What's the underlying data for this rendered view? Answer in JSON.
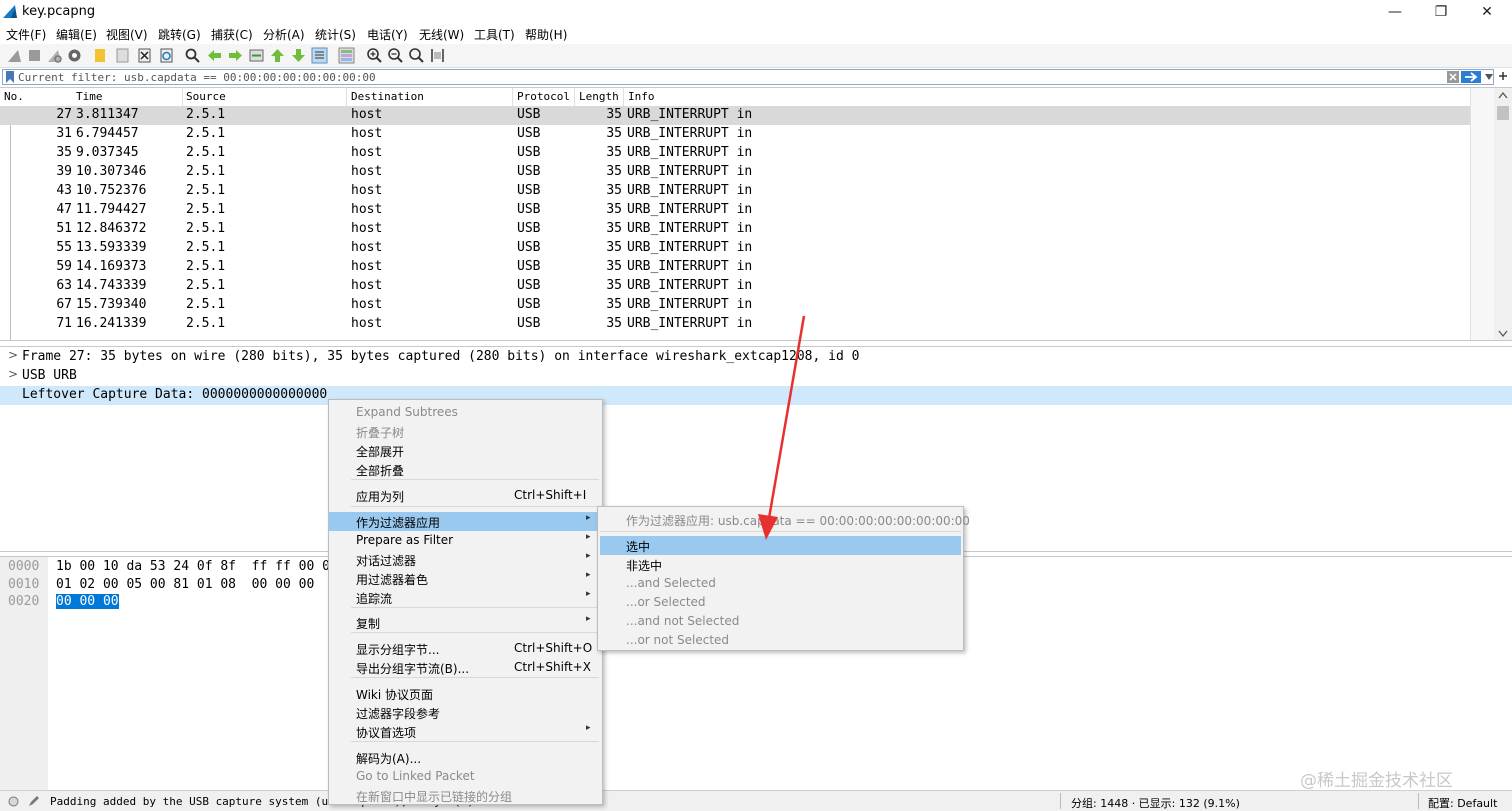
{
  "window": {
    "title": "key.pcapng",
    "controls": {
      "minimize": "—",
      "restore": "❐",
      "close": "✕"
    }
  },
  "menu": [
    {
      "label": "文件(F)"
    },
    {
      "label": "编辑(E)"
    },
    {
      "label": "视图(V)"
    },
    {
      "label": "跳转(G)"
    },
    {
      "label": "捕获(C)"
    },
    {
      "label": "分析(A)"
    },
    {
      "label": "统计(S)"
    },
    {
      "label": "电话(Y)"
    },
    {
      "label": "无线(W)"
    },
    {
      "label": "工具(T)"
    },
    {
      "label": "帮助(H)"
    }
  ],
  "toolbar_icons": [
    "shark-fin-start-icon",
    "stop-icon",
    "restart-icon",
    "capture-options-icon",
    "open-file-icon",
    "save-file-icon",
    "close-file-icon",
    "reload-icon",
    "find-packet-icon",
    "go-back-icon",
    "go-forward-icon",
    "go-to-packet-icon",
    "go-first-icon",
    "go-last-icon",
    "autoscroll-icon",
    "colorize-icon",
    "zoom-in-icon",
    "zoom-out-icon",
    "zoom-reset-icon",
    "resize-columns-icon"
  ],
  "filter": {
    "value": "Current filter: usb.capdata == 00:00:00:00:00:00:00:00"
  },
  "packet_list": {
    "columns": [
      "No.",
      "Time",
      "Source",
      "Destination",
      "Protocol",
      "Length",
      "Info"
    ],
    "rows": [
      {
        "no": "27",
        "time": "3.811347",
        "src": "2.5.1",
        "dst": "host",
        "proto": "USB",
        "len": "35",
        "info": "URB_INTERRUPT in"
      },
      {
        "no": "31",
        "time": "6.794457",
        "src": "2.5.1",
        "dst": "host",
        "proto": "USB",
        "len": "35",
        "info": "URB_INTERRUPT in"
      },
      {
        "no": "35",
        "time": "9.037345",
        "src": "2.5.1",
        "dst": "host",
        "proto": "USB",
        "len": "35",
        "info": "URB_INTERRUPT in"
      },
      {
        "no": "39",
        "time": "10.307346",
        "src": "2.5.1",
        "dst": "host",
        "proto": "USB",
        "len": "35",
        "info": "URB_INTERRUPT in"
      },
      {
        "no": "43",
        "time": "10.752376",
        "src": "2.5.1",
        "dst": "host",
        "proto": "USB",
        "len": "35",
        "info": "URB_INTERRUPT in"
      },
      {
        "no": "47",
        "time": "11.794427",
        "src": "2.5.1",
        "dst": "host",
        "proto": "USB",
        "len": "35",
        "info": "URB_INTERRUPT in"
      },
      {
        "no": "51",
        "time": "12.846372",
        "src": "2.5.1",
        "dst": "host",
        "proto": "USB",
        "len": "35",
        "info": "URB_INTERRUPT in"
      },
      {
        "no": "55",
        "time": "13.593339",
        "src": "2.5.1",
        "dst": "host",
        "proto": "USB",
        "len": "35",
        "info": "URB_INTERRUPT in"
      },
      {
        "no": "59",
        "time": "14.169373",
        "src": "2.5.1",
        "dst": "host",
        "proto": "USB",
        "len": "35",
        "info": "URB_INTERRUPT in"
      },
      {
        "no": "63",
        "time": "14.743339",
        "src": "2.5.1",
        "dst": "host",
        "proto": "USB",
        "len": "35",
        "info": "URB_INTERRUPT in"
      },
      {
        "no": "67",
        "time": "15.739340",
        "src": "2.5.1",
        "dst": "host",
        "proto": "USB",
        "len": "35",
        "info": "URB_INTERRUPT in"
      },
      {
        "no": "71",
        "time": "16.241339",
        "src": "2.5.1",
        "dst": "host",
        "proto": "USB",
        "len": "35",
        "info": "URB_INTERRUPT in"
      }
    ]
  },
  "details": {
    "frame": "Frame 27: 35 bytes on wire (280 bits), 35 bytes captured (280 bits) on interface wireshark_extcap1208, id 0",
    "usb": "USB URB",
    "leftover": "Leftover Capture Data: 0000000000000000"
  },
  "bytes": {
    "offsets": [
      "0000",
      "0010",
      "0020"
    ],
    "line0": "1b 00 10 da 53 24 0f 8f  ff ff 00 0",
    "line1": "01 02 00 05 00 81 01 08  00 00 00",
    "line2_hl": "00 00 00"
  },
  "context_menu": {
    "items": [
      {
        "label": "Expand Subtrees",
        "disabled": true
      },
      {
        "label": "折叠子树",
        "disabled": true
      },
      {
        "label": "全部展开"
      },
      {
        "label": "全部折叠"
      },
      {
        "label": "应用为列",
        "shortcut": "Ctrl+Shift+I"
      },
      {
        "label": "作为过滤器应用",
        "submenu": true,
        "hover": true
      },
      {
        "label": "Prepare as Filter",
        "submenu": true
      },
      {
        "label": "对话过滤器",
        "submenu": true
      },
      {
        "label": "用过滤器着色",
        "submenu": true
      },
      {
        "label": "追踪流",
        "submenu": true
      },
      {
        "label": "复制",
        "submenu": true
      },
      {
        "label": "显示分组字节...",
        "shortcut": "Ctrl+Shift+O"
      },
      {
        "label": "导出分组字节流(B)...",
        "shortcut": "Ctrl+Shift+X"
      },
      {
        "label": "Wiki 协议页面"
      },
      {
        "label": "过滤器字段参考"
      },
      {
        "label": "协议首选项",
        "submenu": true
      },
      {
        "label": "解码为(A)..."
      },
      {
        "label": "Go to Linked Packet",
        "disabled": true
      },
      {
        "label": "在新窗口中显示已链接的分组",
        "disabled": true
      }
    ]
  },
  "submenu": {
    "items": [
      {
        "label": "作为过滤器应用: usb.capdata == 00:00:00:00:00:00:00:00",
        "disabled": true
      },
      {
        "label": "选中",
        "hover": true
      },
      {
        "label": "非选中"
      },
      {
        "label": "...and Selected",
        "disabled": true
      },
      {
        "label": "...or Selected",
        "disabled": true
      },
      {
        "label": "...and not Selected",
        "disabled": true
      },
      {
        "label": "...or not Selected",
        "disabled": true
      }
    ]
  },
  "status": {
    "left": "Padding added by the USB capture system (usb.capdata), 8 byte(s)",
    "packets": "分组: 1448 · 已显示: 132 (9.1%)",
    "profile": "配置: Default"
  },
  "watermark": "@稀土掘金技术社区",
  "colors": {
    "selection_row": "#d9d9d9",
    "detail_selection": "#cfe8fc",
    "byte_highlight": "#0078d7",
    "menu_hover": "#99c9ef",
    "annotation_arrow": "#e8312f"
  }
}
